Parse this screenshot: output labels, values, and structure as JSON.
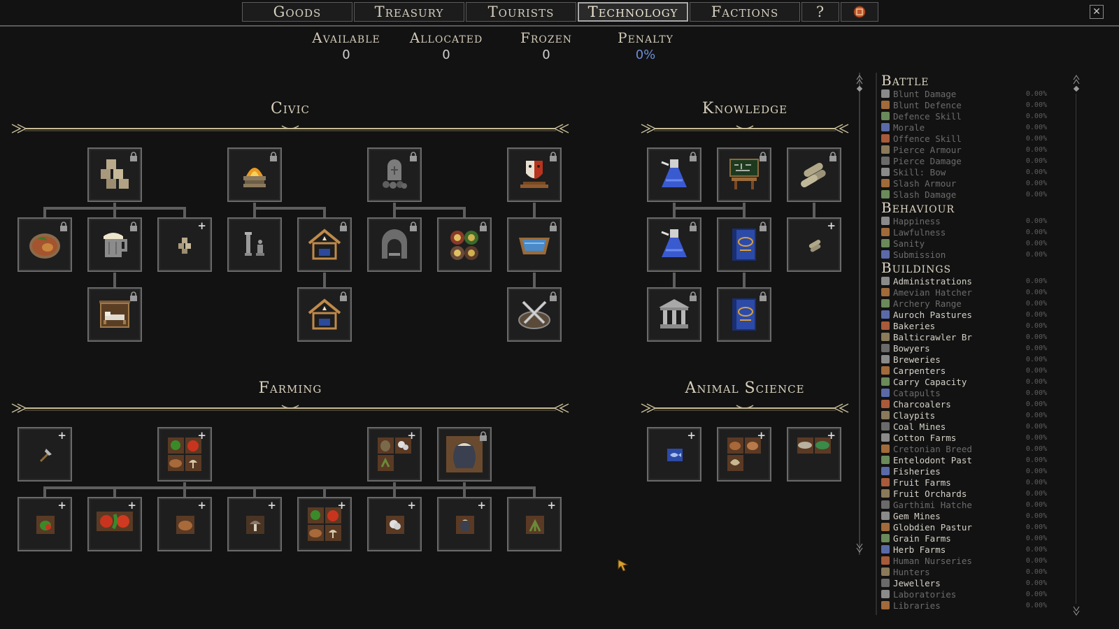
{
  "tabs": [
    {
      "label": "Goods",
      "active": false
    },
    {
      "label": "Treasury",
      "active": false
    },
    {
      "label": "Tourists",
      "active": false
    },
    {
      "label": "Technology",
      "active": true
    },
    {
      "label": "Factions",
      "active": false
    },
    {
      "label": "?",
      "active": false
    }
  ],
  "close_label": "✕",
  "stats": {
    "available": {
      "label": "Available",
      "value": "0"
    },
    "allocated": {
      "label": "Allocated",
      "value": "0"
    },
    "frozen": {
      "label": "Frozen",
      "value": "0"
    },
    "penalty": {
      "label": "Penalty",
      "value": "0%"
    }
  },
  "sections": {
    "civic": "Civic",
    "knowledge": "Knowledge",
    "farming": "Farming",
    "animal_science": "Animal Science"
  },
  "icons": {
    "civic": [
      "stone-blocks-icon",
      "fire-pit-icon",
      "gravestone-icon",
      "theater-mask-icon",
      "roast-meal-icon",
      "beer-mug-icon",
      "small-stone-icon",
      "statue-icon",
      "shrine-house-icon",
      "stone-oven-icon",
      "tapestry-icon",
      "bath-icon",
      "inn-sign-bed-icon",
      "shrine-house-icon",
      "crossed-swords-icon"
    ],
    "knowledge": [
      "flask-icon",
      "chalkboard-desk-icon",
      "scroll-bundle-icon",
      "flask-icon",
      "blue-book-icon",
      "small-scroll-icon",
      "columns-building-icon",
      "blue-book-icon"
    ],
    "farming": [
      "axe-icon",
      "produce-crate-icon",
      "farm-goods-icon",
      "seed-sack-icon",
      "vegetable-icon",
      "apples-icon",
      "bread-icon",
      "mushroom-icon",
      "produce-crate-icon",
      "cotton-icon",
      "sack-icon",
      "herb-icon"
    ],
    "animal_science": [
      "fish-map-icon",
      "livestock-icon",
      "worm-creature-icon"
    ]
  },
  "right_panel": {
    "categories": [
      {
        "name": "Battle",
        "items": [
          {
            "label": "Blunt Damage",
            "value": "0.00%",
            "enabled": false
          },
          {
            "label": "Blunt Defence",
            "value": "0.00%",
            "enabled": false
          },
          {
            "label": "Defence Skill",
            "value": "0.00%",
            "enabled": false
          },
          {
            "label": "Morale",
            "value": "0.00%",
            "enabled": false
          },
          {
            "label": "Offence Skill",
            "value": "0.00%",
            "enabled": false
          },
          {
            "label": "Pierce Armour",
            "value": "0.00%",
            "enabled": false
          },
          {
            "label": "Pierce Damage",
            "value": "0.00%",
            "enabled": false
          },
          {
            "label": "Skill: Bow",
            "value": "0.00%",
            "enabled": false
          },
          {
            "label": "Slash Armour",
            "value": "0.00%",
            "enabled": false
          },
          {
            "label": "Slash Damage",
            "value": "0.00%",
            "enabled": false
          }
        ]
      },
      {
        "name": "Behaviour",
        "items": [
          {
            "label": "Happiness",
            "value": "0.00%",
            "enabled": false
          },
          {
            "label": "Lawfulness",
            "value": "0.00%",
            "enabled": false
          },
          {
            "label": "Sanity",
            "value": "0.00%",
            "enabled": false
          },
          {
            "label": "Submission",
            "value": "0.00%",
            "enabled": false
          }
        ]
      },
      {
        "name": "Buildings",
        "items": [
          {
            "label": "Administrations",
            "value": "0.00%",
            "enabled": true
          },
          {
            "label": "Amevian Hatcher",
            "value": "0.00%",
            "enabled": false
          },
          {
            "label": "Archery Range",
            "value": "0.00%",
            "enabled": false
          },
          {
            "label": "Auroch Pastures",
            "value": "0.00%",
            "enabled": true
          },
          {
            "label": "Bakeries",
            "value": "0.00%",
            "enabled": true
          },
          {
            "label": "Balticrawler Br",
            "value": "0.00%",
            "enabled": true
          },
          {
            "label": "Bowyers",
            "value": "0.00%",
            "enabled": true
          },
          {
            "label": "Breweries",
            "value": "0.00%",
            "enabled": true
          },
          {
            "label": "Carpenters",
            "value": "0.00%",
            "enabled": true
          },
          {
            "label": "Carry Capacity",
            "value": "0.00%",
            "enabled": true
          },
          {
            "label": "Catapults",
            "value": "0.00%",
            "enabled": false
          },
          {
            "label": "Charcoalers",
            "value": "0.00%",
            "enabled": true
          },
          {
            "label": "Claypits",
            "value": "0.00%",
            "enabled": true
          },
          {
            "label": "Coal Mines",
            "value": "0.00%",
            "enabled": true
          },
          {
            "label": "Cotton Farms",
            "value": "0.00%",
            "enabled": true
          },
          {
            "label": "Cretonian Breed",
            "value": "0.00%",
            "enabled": false
          },
          {
            "label": "Entelodont Past",
            "value": "0.00%",
            "enabled": true
          },
          {
            "label": "Fisheries",
            "value": "0.00%",
            "enabled": true
          },
          {
            "label": "Fruit Farms",
            "value": "0.00%",
            "enabled": true
          },
          {
            "label": "Fruit Orchards",
            "value": "0.00%",
            "enabled": true
          },
          {
            "label": "Garthimi Hatche",
            "value": "0.00%",
            "enabled": false
          },
          {
            "label": "Gem Mines",
            "value": "0.00%",
            "enabled": true
          },
          {
            "label": "Globdien Pastur",
            "value": "0.00%",
            "enabled": true
          },
          {
            "label": "Grain Farms",
            "value": "0.00%",
            "enabled": true
          },
          {
            "label": "Herb Farms",
            "value": "0.00%",
            "enabled": true
          },
          {
            "label": "Human Nurseries",
            "value": "0.00%",
            "enabled": false
          },
          {
            "label": "Hunters",
            "value": "0.00%",
            "enabled": false
          },
          {
            "label": "Jewellers",
            "value": "0.00%",
            "enabled": true
          },
          {
            "label": "Laboratories",
            "value": "0.00%",
            "enabled": false
          },
          {
            "label": "Libraries",
            "value": "0.00%",
            "enabled": false
          }
        ]
      }
    ]
  },
  "colors": {
    "accent_blue": "#6b8fd6",
    "text": "#c9c1b0",
    "disabled": "#6c6c6c",
    "enabled": "#d6d2c8"
  }
}
